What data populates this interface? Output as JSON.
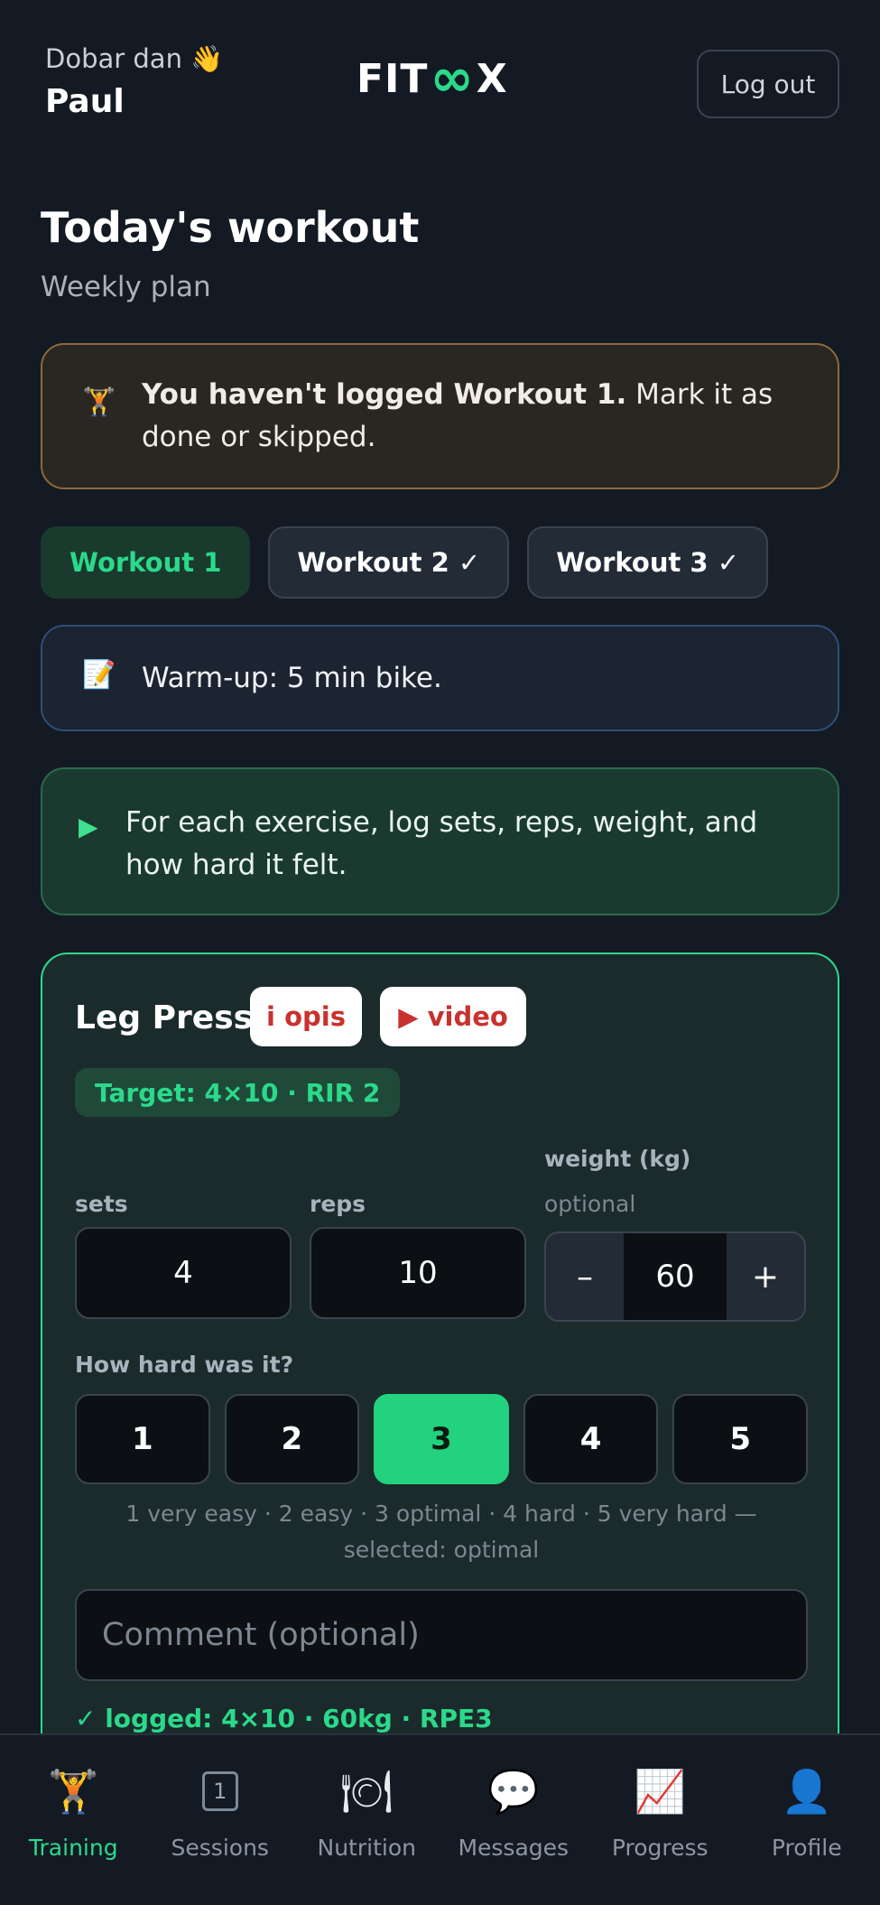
{
  "header": {
    "greeting": "Dobar dan 👋",
    "username": "Paul",
    "logo_left": "FIT",
    "logo_mid": "∞",
    "logo_right": "X",
    "logout_label": "Log out"
  },
  "page": {
    "title": "Today's workout",
    "subtitle": "Weekly plan"
  },
  "alert": {
    "icon": "🏋",
    "bold_text": "You haven't logged Workout 1.",
    "text": " Mark it as done or skipped."
  },
  "tabs": [
    {
      "label": "Workout 1",
      "active": true
    },
    {
      "label": "Workout 2 ✓",
      "active": false
    },
    {
      "label": "Workout 3 ✓",
      "active": false
    }
  ],
  "note": {
    "icon": "📝",
    "text": "Warm-up: 5 min bike."
  },
  "info": {
    "icon": "▶",
    "text": "For each exercise, log sets, reps, weight, and how hard it felt."
  },
  "exercise": {
    "name": "Leg Press",
    "opis_label": "i opis",
    "video_label": "▶ video",
    "target": "Target: 4×10 · RIR 2",
    "sets_label": "sets",
    "sets_value": "4",
    "reps_label": "reps",
    "reps_value": "10",
    "weight_label": "weight (kg)",
    "weight_hint": "optional",
    "weight_minus": "–",
    "weight_value": "60",
    "weight_plus": "+",
    "rpe_label": "How hard was it?",
    "rpe_options": [
      "1",
      "2",
      "3",
      "4",
      "5"
    ],
    "rpe_selected": 3,
    "rpe_legend": "1 very easy · 2 easy · 3 optimal · 4 hard · 5 very hard — selected: optimal",
    "comment_placeholder": "Comment (optional)",
    "logged_text": "✓ logged: 4×10 · 60kg · RPE3"
  },
  "bottom_nav": [
    {
      "label": "Training",
      "icon": "🏋",
      "active": true
    },
    {
      "label": "Sessions",
      "icon": "1",
      "active": false
    },
    {
      "label": "Nutrition",
      "icon": "🍽",
      "active": false
    },
    {
      "label": "Messages",
      "icon": "💬",
      "active": false
    },
    {
      "label": "Progress",
      "icon": "📈",
      "active": false
    },
    {
      "label": "Profile",
      "icon": "👤",
      "active": false
    }
  ],
  "colors": {
    "accent": "#2bd98b",
    "background": "#141a23",
    "danger": "#c8322e"
  }
}
